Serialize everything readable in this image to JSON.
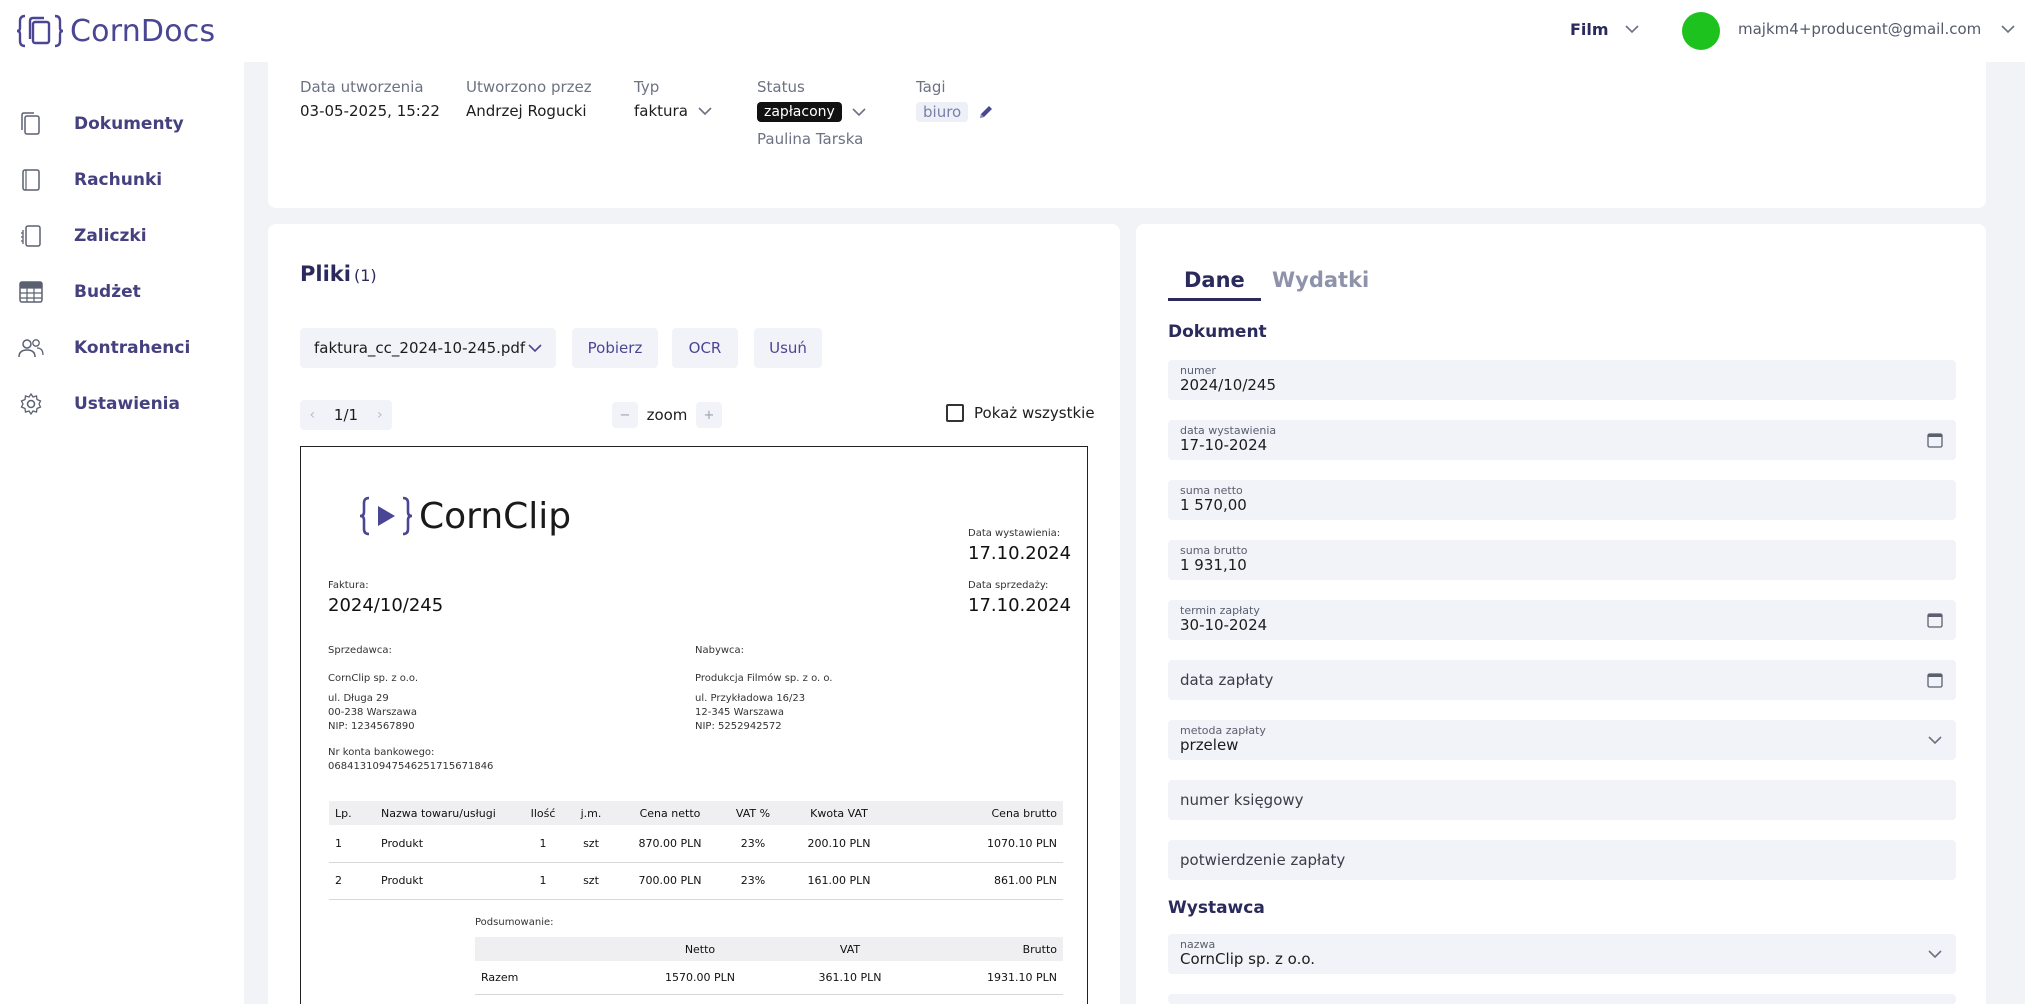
{
  "header": {
    "logo_text": "CornDocs",
    "project": "Film",
    "user_email": "majkm4+producent@gmail.com",
    "avatar_color": "#1ec21e",
    "brand_color": "#4b4694"
  },
  "sidebar": {
    "items": [
      {
        "label": "Dokumenty",
        "icon": "document-icon"
      },
      {
        "label": "Rachunki",
        "icon": "receipt-icon"
      },
      {
        "label": "Zaliczki",
        "icon": "stack-icon"
      },
      {
        "label": "Budżet",
        "icon": "table-icon"
      },
      {
        "label": "Kontrahenci",
        "icon": "people-icon"
      },
      {
        "label": "Ustawienia",
        "icon": "gear-icon"
      }
    ]
  },
  "info": {
    "created_label": "Data utworzenia",
    "created_value": "03-05-2025, 15:22",
    "created_by_label": "Utworzono przez",
    "created_by_value": "Andrzej Rogucki",
    "type_label": "Typ",
    "type_value": "faktura",
    "status_label": "Status",
    "status_value": "zapłacony",
    "status_person": "Paulina Tarska",
    "tags_label": "Tagi",
    "tag_value": "biuro"
  },
  "files": {
    "title": "Pliki",
    "count": "(1)",
    "selected_file": "faktura_cc_2024-10-245.pdf",
    "download_label": "Pobierz",
    "ocr_label": "OCR",
    "delete_label": "Usuń",
    "page": "1/1",
    "zoom_label": "zoom",
    "zoom_minus": "−",
    "zoom_plus": "+",
    "show_all_label": "Pokaż wszystkie"
  },
  "invoice": {
    "logo_text": "CornClip",
    "issue_date_label": "Data wystawienia:",
    "issue_date": "17.10.2024",
    "sale_date_label": "Data sprzedaży:",
    "sale_date": "17.10.2024",
    "invoice_label": "Faktura:",
    "invoice_number": "2024/10/245",
    "seller_label": "Sprzedawca:",
    "seller_name": "CornClip sp. z o.o.",
    "seller_street": "ul. Długa 29",
    "seller_city": "00-238 Warszawa",
    "seller_nip": "NIP: 1234567890",
    "buyer_label": "Nabywca:",
    "buyer_name": "Produkcja Filmów sp. z o. o.",
    "buyer_street": "ul. Przykładowa 16/23",
    "buyer_city": "12-345 Warszawa",
    "buyer_nip": "NIP: 5252942572",
    "account_label": "Nr konta bankowego:",
    "account_number": "06841310947546251715671846",
    "table_headers": [
      "Lp.",
      "Nazwa towaru/usługi",
      "Ilość",
      "j.m.",
      "Cena netto",
      "VAT %",
      "Kwota VAT",
      "Cena brutto"
    ],
    "rows": [
      [
        "1",
        "Produkt",
        "1",
        "szt",
        "870.00 PLN",
        "23%",
        "200.10 PLN",
        "1070.10 PLN"
      ],
      [
        "2",
        "Produkt",
        "1",
        "szt",
        "700.00 PLN",
        "23%",
        "161.00 PLN",
        "861.00 PLN"
      ]
    ],
    "summary_label": "Podsumowanie:",
    "summary_headers": [
      "",
      "Netto",
      "VAT",
      "Brutto"
    ],
    "summary_row": [
      "Razem",
      "1570.00 PLN",
      "361.10 PLN",
      "1931.10 PLN"
    ]
  },
  "data_panel": {
    "tab_data": "Dane",
    "tab_expenses": "Wydatki",
    "section_document": "Dokument",
    "number_label": "numer",
    "number_value": "2024/10/245",
    "issue_label": "data wystawienia",
    "issue_value": "17-10-2024",
    "net_label": "suma netto",
    "net_value": "1 570,00",
    "gross_label": "suma brutto",
    "gross_value": "1 931,10",
    "due_label": "termin zapłaty",
    "due_value": "30-10-2024",
    "payment_date_placeholder": "data zapłaty",
    "method_label": "metoda zapłaty",
    "method_value": "przelew",
    "accountant_placeholder": "numer księgowy",
    "confirmation_placeholder": "potwierdzenie zapłaty",
    "section_issuer": "Wystawca",
    "issuer_label": "nazwa",
    "issuer_value": "CornClip sp. z o.o."
  }
}
